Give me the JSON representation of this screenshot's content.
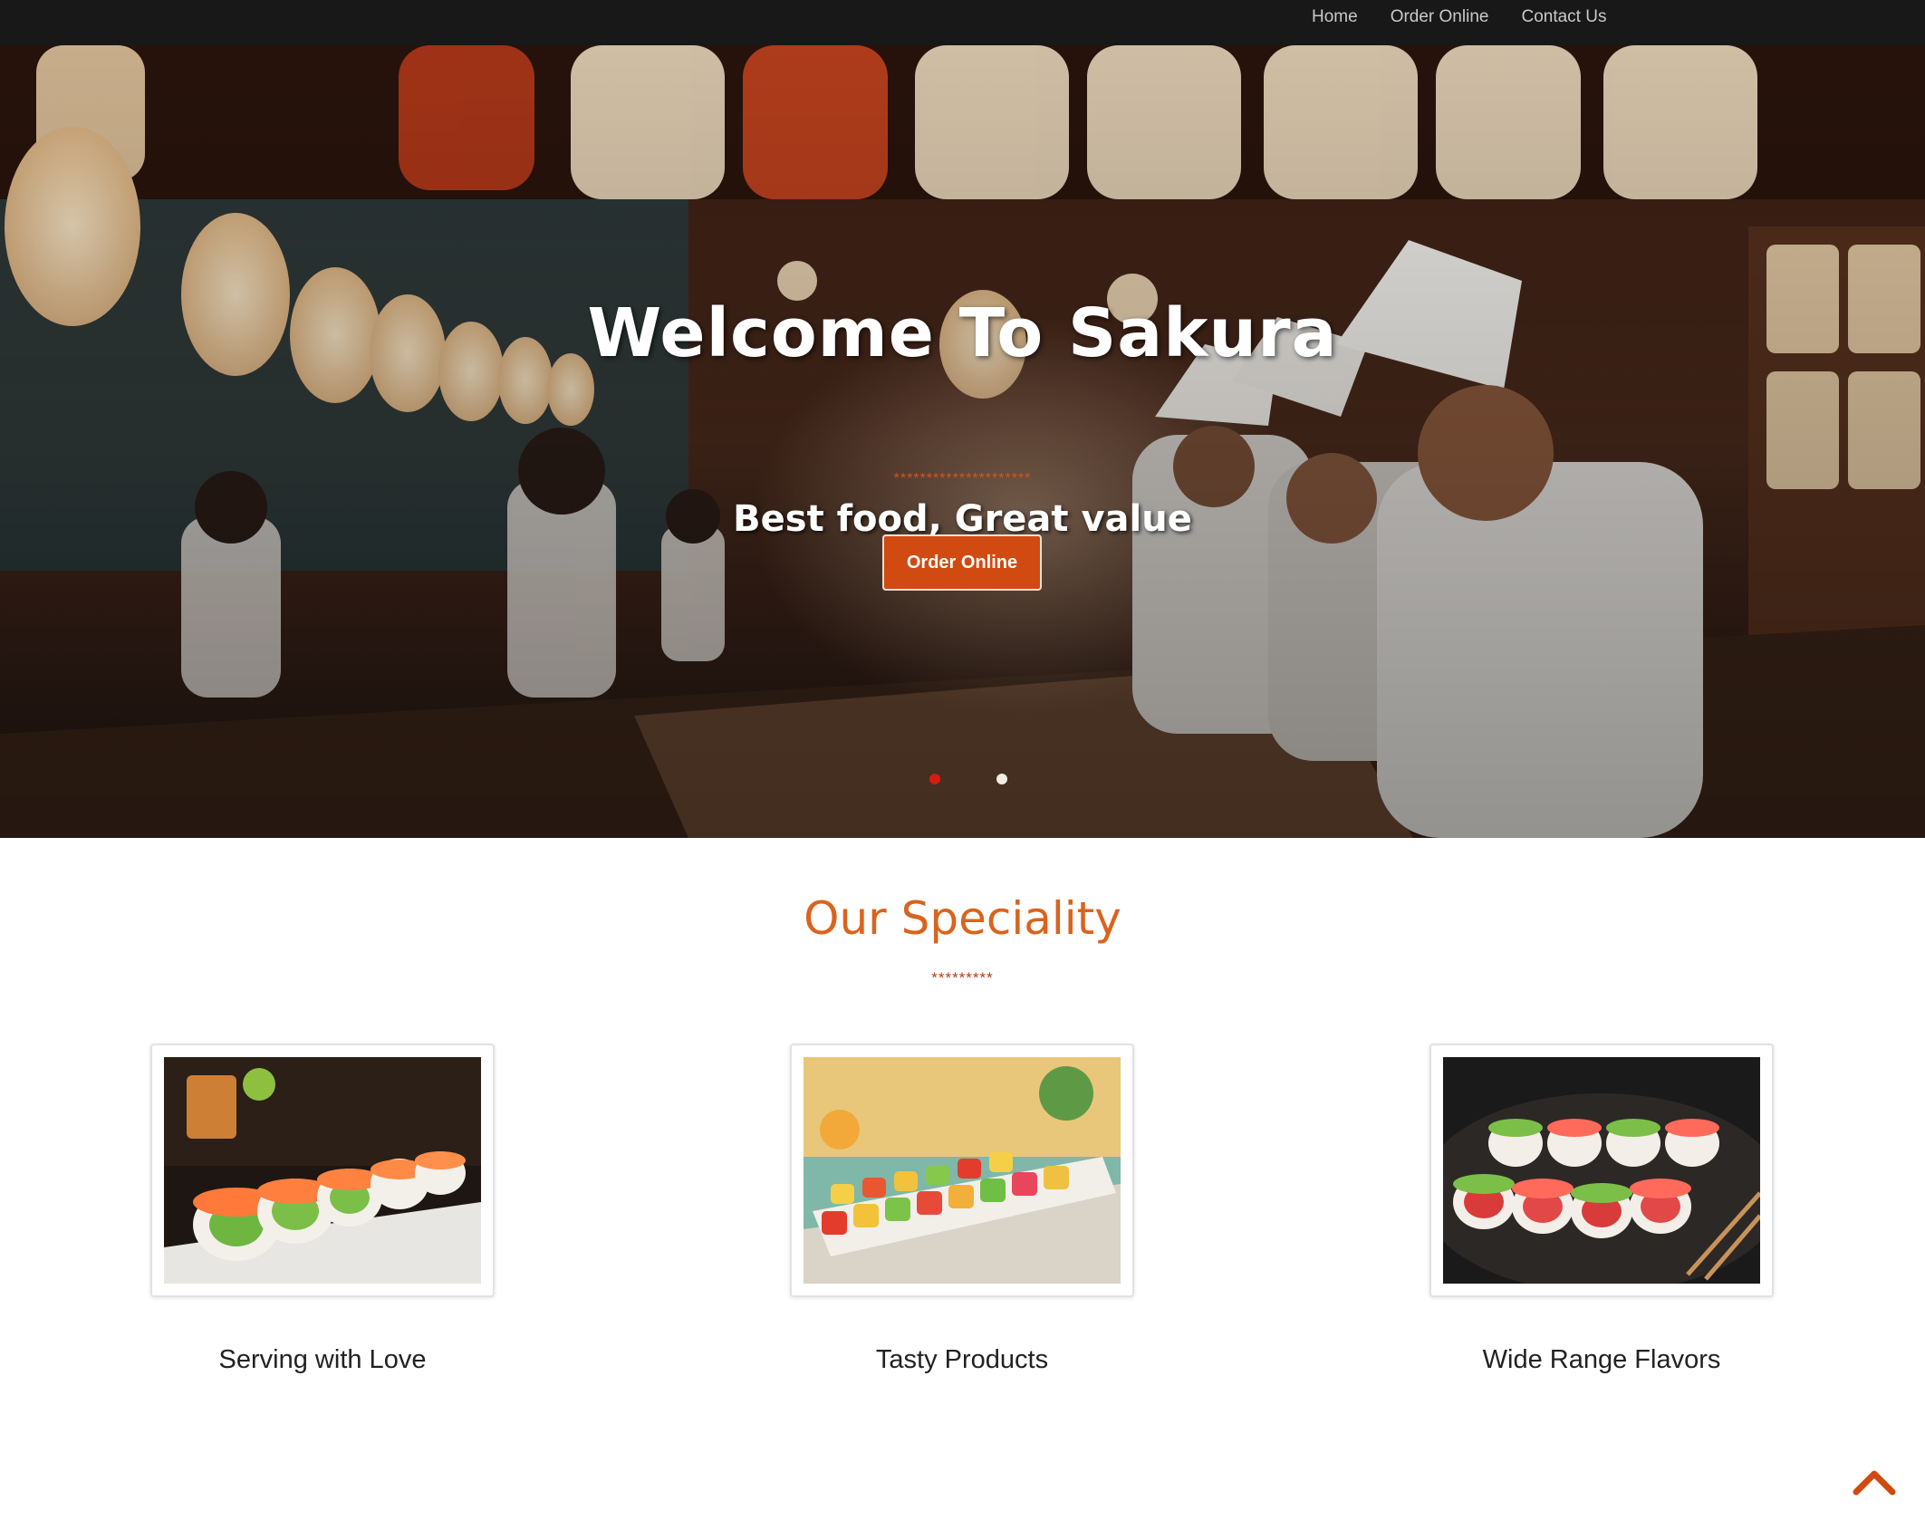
{
  "nav": {
    "home": "Home",
    "order_online": "Order Online",
    "contact_us": "Contact Us"
  },
  "hero": {
    "title": "Welcome To Sakura",
    "stars": "*********************",
    "subtitle": "Best food, Great value",
    "cta_label": "Order Online",
    "slide_count": 2,
    "active_slide": 1,
    "colors": {
      "accent": "#d14a11",
      "active_dot": "#d61c0e"
    }
  },
  "speciality": {
    "title": "Our Speciality",
    "stars": "*********",
    "items": [
      {
        "caption": "Serving with Love"
      },
      {
        "caption": "Tasty Products"
      },
      {
        "caption": "Wide Range Flavors"
      }
    ]
  },
  "scroll_top_icon": "chevron-up-icon"
}
